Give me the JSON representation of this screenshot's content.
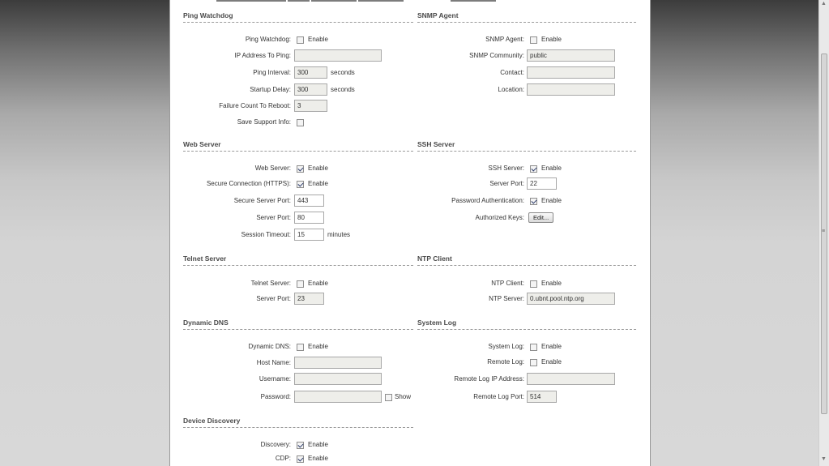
{
  "sections": {
    "ping_watchdog": {
      "title": "Ping Watchdog",
      "enable_label": "Ping Watchdog:",
      "enable_text": "Enable",
      "ip_label": "IP Address To Ping:",
      "ip_value": "",
      "interval_label": "Ping Interval:",
      "interval_value": "300",
      "interval_unit": "seconds",
      "startup_label": "Startup Delay:",
      "startup_value": "300",
      "startup_unit": "seconds",
      "failure_label": "Failure Count To Reboot:",
      "failure_value": "3",
      "support_label": "Save Support Info:"
    },
    "snmp_agent": {
      "title": "SNMP Agent",
      "enable_label": "SNMP Agent:",
      "enable_text": "Enable",
      "community_label": "SNMP Community:",
      "community_value": "public",
      "contact_label": "Contact:",
      "contact_value": "",
      "location_label": "Location:",
      "location_value": ""
    },
    "web_server": {
      "title": "Web Server",
      "enable_label": "Web Server:",
      "enable_text": "Enable",
      "https_label": "Secure Connection (HTTPS):",
      "https_text": "Enable",
      "secure_port_label": "Secure Server Port:",
      "secure_port_value": "443",
      "port_label": "Server Port:",
      "port_value": "80",
      "timeout_label": "Session Timeout:",
      "timeout_value": "15",
      "timeout_unit": "minutes"
    },
    "ssh_server": {
      "title": "SSH Server",
      "enable_label": "SSH Server:",
      "enable_text": "Enable",
      "port_label": "Server Port:",
      "port_value": "22",
      "password_label": "Password Authentication:",
      "password_text": "Enable",
      "keys_label": "Authorized Keys:",
      "keys_button": "Edit..."
    },
    "telnet_server": {
      "title": "Telnet Server",
      "enable_label": "Telnet Server:",
      "enable_text": "Enable",
      "port_label": "Server Port:",
      "port_value": "23"
    },
    "ntp_client": {
      "title": "NTP Client",
      "enable_label": "NTP Client:",
      "enable_text": "Enable",
      "server_label": "NTP Server:",
      "server_value": "0.ubnt.pool.ntp.org"
    },
    "dynamic_dns": {
      "title": "Dynamic DNS",
      "enable_label": "Dynamic DNS:",
      "enable_text": "Enable",
      "host_label": "Host Name:",
      "host_value": "",
      "user_label": "Username:",
      "user_value": "",
      "pass_label": "Password:",
      "pass_value": "",
      "show_text": "Show"
    },
    "system_log": {
      "title": "System Log",
      "enable_label": "System Log:",
      "enable_text": "Enable",
      "remote_label": "Remote Log:",
      "remote_text": "Enable",
      "remote_ip_label": "Remote Log IP Address:",
      "remote_ip_value": "",
      "remote_port_label": "Remote Log Port:",
      "remote_port_value": "514"
    },
    "device_discovery": {
      "title": "Device Discovery",
      "discovery_label": "Discovery:",
      "discovery_text": "Enable",
      "cdp_label": "CDP:",
      "cdp_text": "Enable"
    }
  },
  "states": {
    "ping_watchdog": false,
    "save_support": false,
    "snmp_agent": false,
    "web_server": true,
    "https": true,
    "ssh_server": true,
    "password_auth": true,
    "telnet": false,
    "ntp": false,
    "dynamic_dns": false,
    "show_password": false,
    "system_log": false,
    "remote_log": false,
    "discovery": true,
    "cdp": true
  },
  "colors": {
    "panel": "#ffffff",
    "input_bg": "#eeeeea",
    "section_title": "#4a4a4a"
  }
}
